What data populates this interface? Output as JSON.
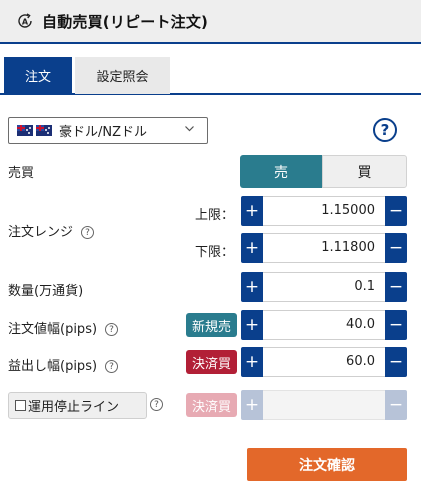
{
  "header": {
    "title": "自動売買(リピート注文)",
    "icon": "auto-trade-icon"
  },
  "tabs": [
    {
      "label": "注文",
      "active": true
    },
    {
      "label": "設定照会",
      "active": false
    }
  ],
  "pair_select": {
    "value": "豪ドル/NZドル",
    "icon": "flag-icons"
  },
  "help_icon": "?",
  "side": {
    "label": "売買",
    "sell": "売",
    "buy": "買",
    "selected": "sell"
  },
  "range": {
    "label": "注文レンジ",
    "upper_label": "上限：",
    "upper_value": "1.15000",
    "lower_label": "下限：",
    "lower_value": "1.11800"
  },
  "quantity": {
    "label": "数量(万通貨)",
    "value": "0.1"
  },
  "order_width": {
    "label": "注文値幅(pips)",
    "badge": "新規売",
    "value": "40.0"
  },
  "profit_width": {
    "label": "益出し幅(pips)",
    "badge": "決済買",
    "value": "60.0"
  },
  "stop_line": {
    "label": "運用停止ライン",
    "badge": "決済買",
    "value": ""
  },
  "stepper_symbols": {
    "plus": "+",
    "minus": "−"
  },
  "info_symbol": "?",
  "confirm_button": "注文確認",
  "colors": {
    "accent_navy": "#0a3f8c",
    "teal": "#2a7c8e",
    "red": "#b21f36",
    "orange": "#e3682a"
  }
}
